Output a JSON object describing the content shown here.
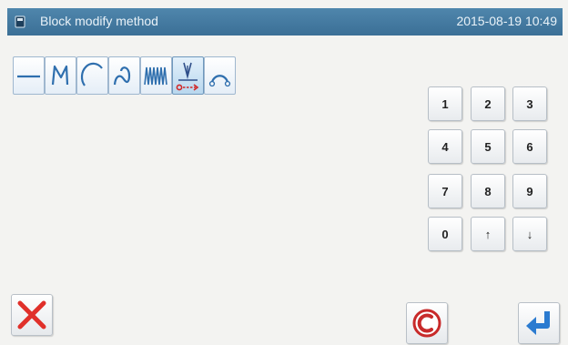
{
  "titlebar": {
    "title": "Block modify method",
    "datetime": "2015-08-19 10:49",
    "icon": "memory-card-icon"
  },
  "tools": [
    {
      "name": "line-tool",
      "icon": "straight-line-icon",
      "selected": false
    },
    {
      "name": "polyline-tool",
      "icon": "polyline-icon",
      "selected": false
    },
    {
      "name": "arc-tool",
      "icon": "arc-icon",
      "selected": false
    },
    {
      "name": "curve-tool",
      "icon": "curve-icon",
      "selected": false
    },
    {
      "name": "zigzag-tool",
      "icon": "zigzag-stitch-icon",
      "selected": false
    },
    {
      "name": "feed-point-tool",
      "icon": "needle-feed-icon",
      "selected": true
    },
    {
      "name": "point-arc-tool",
      "icon": "point-arc-icon",
      "selected": false
    }
  ],
  "keypad": {
    "keys": [
      "1",
      "2",
      "3",
      "4",
      "5",
      "6",
      "7",
      "8",
      "9",
      "0",
      "↑",
      "↓"
    ]
  },
  "buttons": {
    "cancel_icon": "close-icon",
    "clear_icon": "c-clear-icon",
    "confirm_icon": "enter-icon"
  },
  "colors": {
    "titlebar": "#3f759c",
    "tool_stroke": "#2f6fae",
    "cancel": "#e0302a",
    "clear": "#c82a2a",
    "confirm": "#2b7bd0"
  }
}
